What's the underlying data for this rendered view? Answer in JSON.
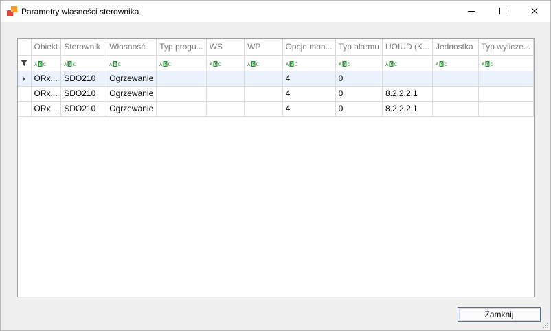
{
  "window": {
    "title": "Parametry własności sterownika",
    "minimize_icon": "minimize-icon",
    "maximize_icon": "maximize-icon",
    "close_icon": "close-icon"
  },
  "grid": {
    "columns": [
      "Obiekt",
      "Sterownik",
      "Własność",
      "Typ progu...",
      "WS",
      "WP",
      "Opcje mon...",
      "Typ alarmu",
      "UOIUD (K...",
      "Jednostka",
      "Typ wylicze..."
    ],
    "filter_row_icon": "filter-icon",
    "filter_cell_icon": "abc-text-filter-icon",
    "rows": [
      [
        "ORx...",
        "SDO210",
        "Ogrzewanie",
        "",
        "",
        "",
        "4",
        "0",
        "",
        "",
        ""
      ],
      [
        "ORx...",
        "SDO210",
        "Ogrzewanie",
        "",
        "",
        "",
        "4",
        "0",
        "8.2.2.2.1",
        "",
        ""
      ],
      [
        "ORx...",
        "SDO210",
        "Ogrzewanie",
        "",
        "",
        "",
        "4",
        "0",
        "8.2.2.2.1",
        "",
        ""
      ]
    ],
    "focused_row_indicator": "row-indicator-arrow-icon",
    "colors": {
      "selected_row": "#eaf3fb",
      "header_text": "#7a7a7a",
      "filter_icon_green": "#2e8b3a"
    }
  },
  "buttons": {
    "close_label": "Zamknij"
  }
}
